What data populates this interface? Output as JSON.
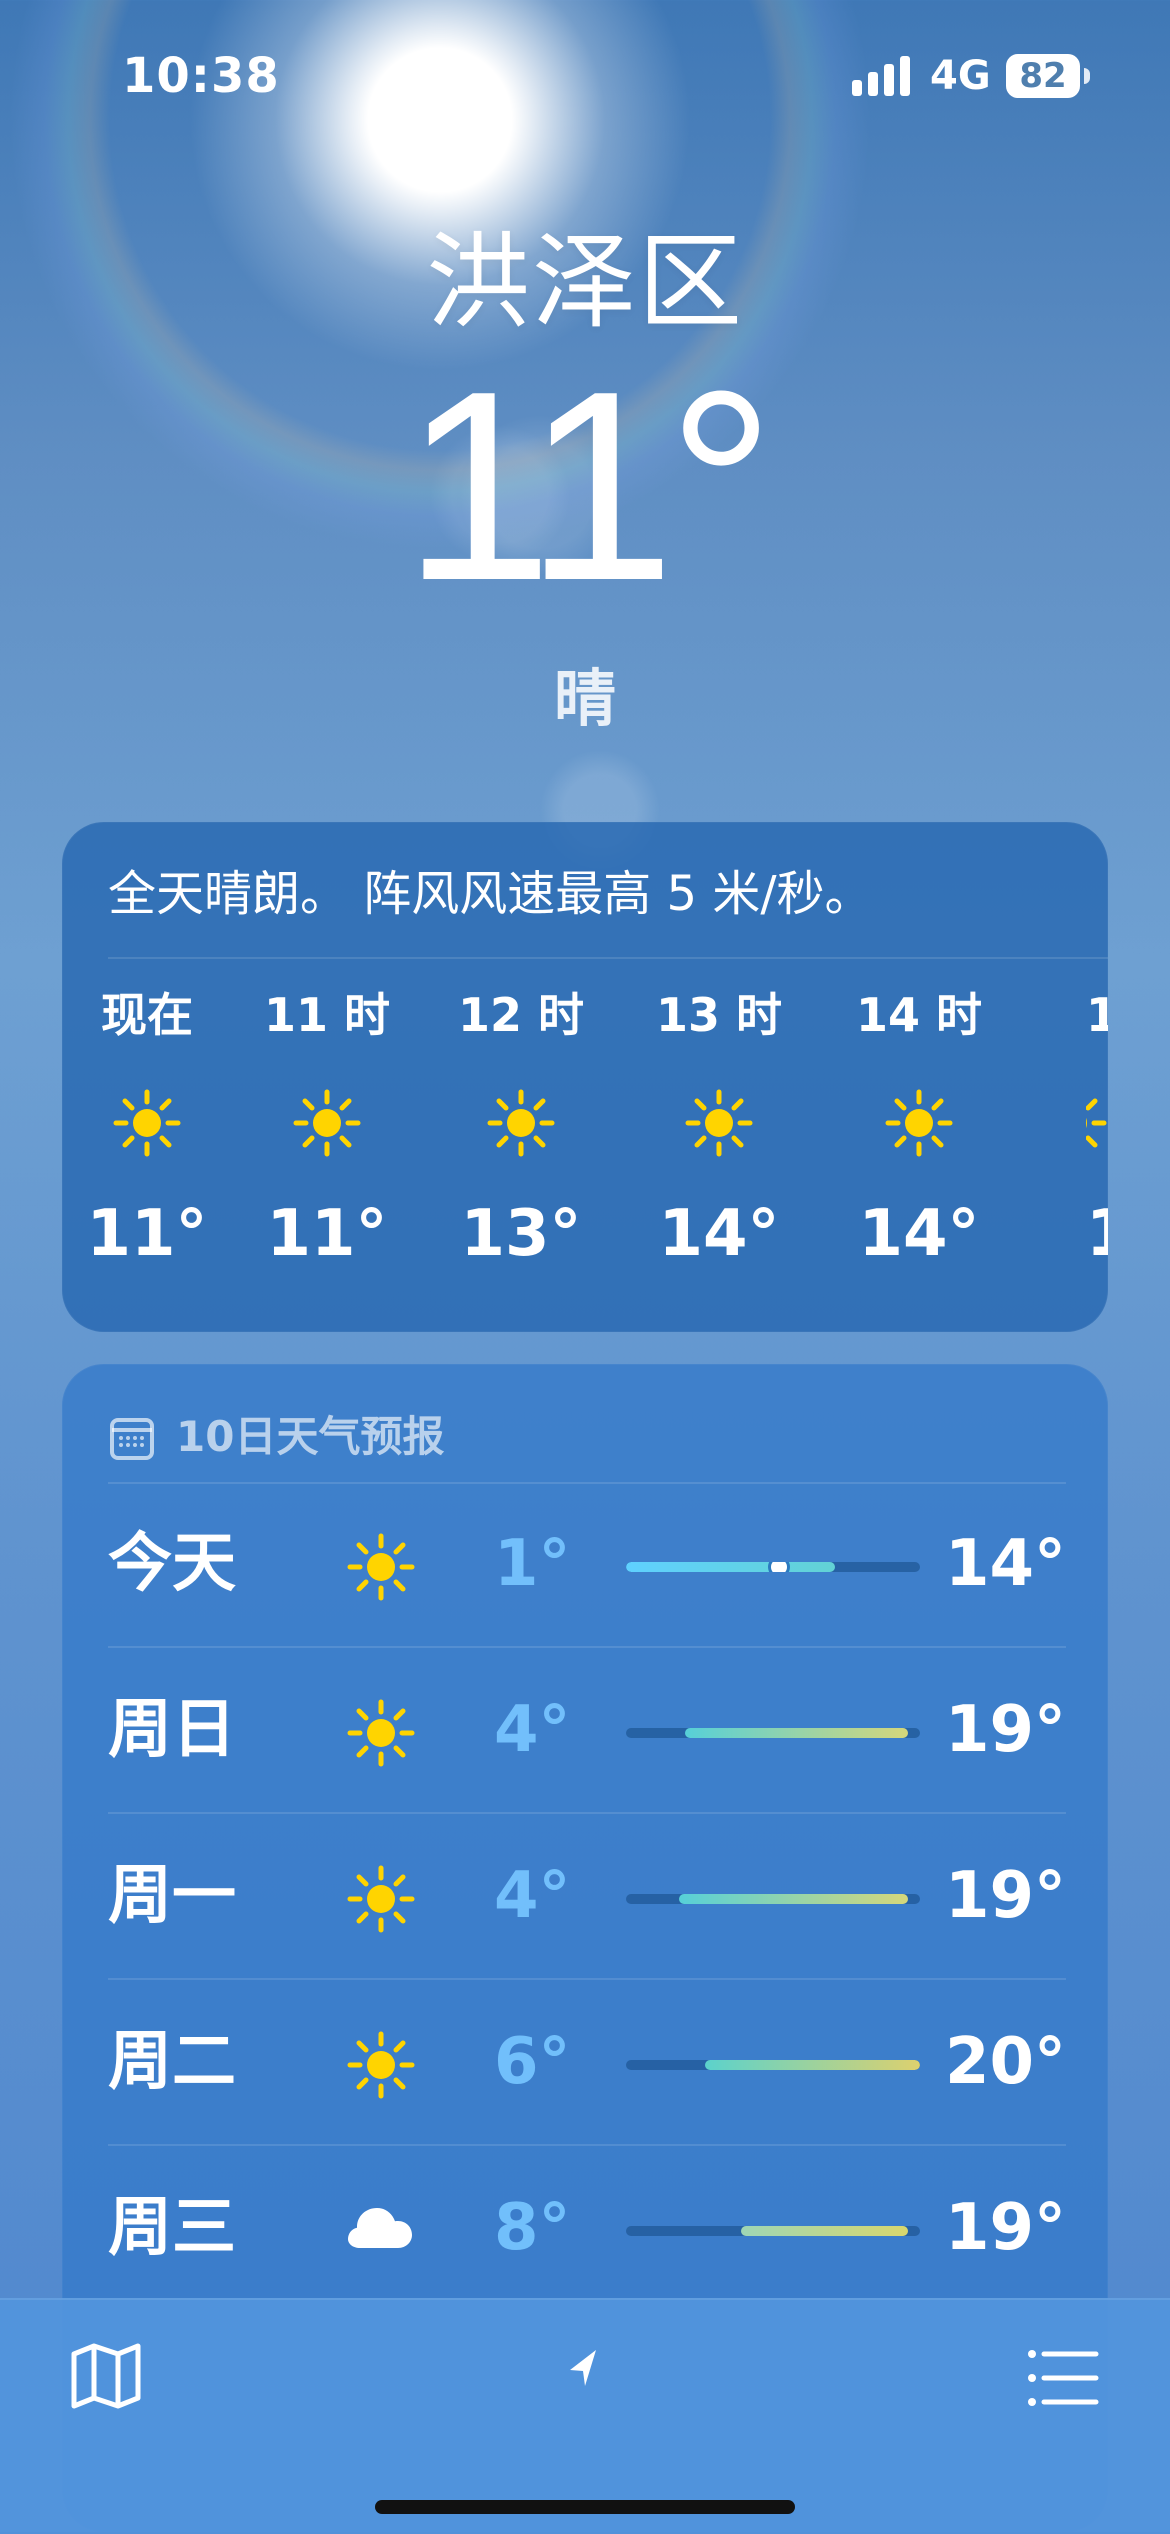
{
  "status_bar": {
    "time": "10:38",
    "network": "4G",
    "battery": "82",
    "icons": {
      "signal": "cellular-signal-icon",
      "battery": "battery-icon"
    }
  },
  "current": {
    "location": "洪泽区",
    "temperature": "11°",
    "condition": "晴"
  },
  "summary_card": {
    "text": "全天晴朗。 阵风风速最高 5 米/秒。",
    "hourly": [
      {
        "time": "现在",
        "icon": "sun-icon",
        "temp": "11°"
      },
      {
        "time": "11 时",
        "icon": "sun-icon",
        "temp": "11°"
      },
      {
        "time": "12 时",
        "icon": "sun-icon",
        "temp": "13°"
      },
      {
        "time": "13 时",
        "icon": "sun-icon",
        "temp": "14°"
      },
      {
        "time": "14 时",
        "icon": "sun-icon",
        "temp": "14°"
      },
      {
        "time": "1",
        "icon": "sun-icon",
        "temp": "1"
      }
    ]
  },
  "forecast_card": {
    "title": "10日天气预报",
    "icon": "calendar-icon",
    "days": [
      {
        "day": "今天",
        "icon": "sun-icon",
        "low": "1°",
        "high": "14°",
        "range_start": 0.0,
        "range_end": 0.71,
        "current_marker": 0.52,
        "color_start": "#5fd1ff",
        "color_end": "#62d2d5"
      },
      {
        "day": "周日",
        "icon": "sun-icon",
        "low": "4°",
        "high": "19°",
        "range_start": 0.2,
        "range_end": 0.96,
        "color_start": "#56d0d8",
        "color_end": "#d5d77b"
      },
      {
        "day": "周一",
        "icon": "sun-icon",
        "low": "4°",
        "high": "19°",
        "range_start": 0.18,
        "range_end": 0.96,
        "color_start": "#56d0d8",
        "color_end": "#d5d77b"
      },
      {
        "day": "周二",
        "icon": "sun-icon",
        "low": "6°",
        "high": "20°",
        "range_start": 0.27,
        "range_end": 1.0,
        "color_start": "#5bd2cc",
        "color_end": "#ddd16e"
      },
      {
        "day": "周三",
        "icon": "cloud-icon",
        "low": "8°",
        "high": "19°",
        "range_start": 0.39,
        "range_end": 0.96,
        "color_start": "#9ed6b5",
        "color_end": "#d8d76e"
      }
    ]
  },
  "bottom_bar": {
    "left_icon": "map-icon",
    "center_icon": "location-arrow-icon",
    "right_icon": "list-icon"
  },
  "colors": {
    "sun": "#ffd400",
    "card": "#2f70b6",
    "forecast_card": "#3a7ec9",
    "low_temp": "#7cc8ff"
  }
}
